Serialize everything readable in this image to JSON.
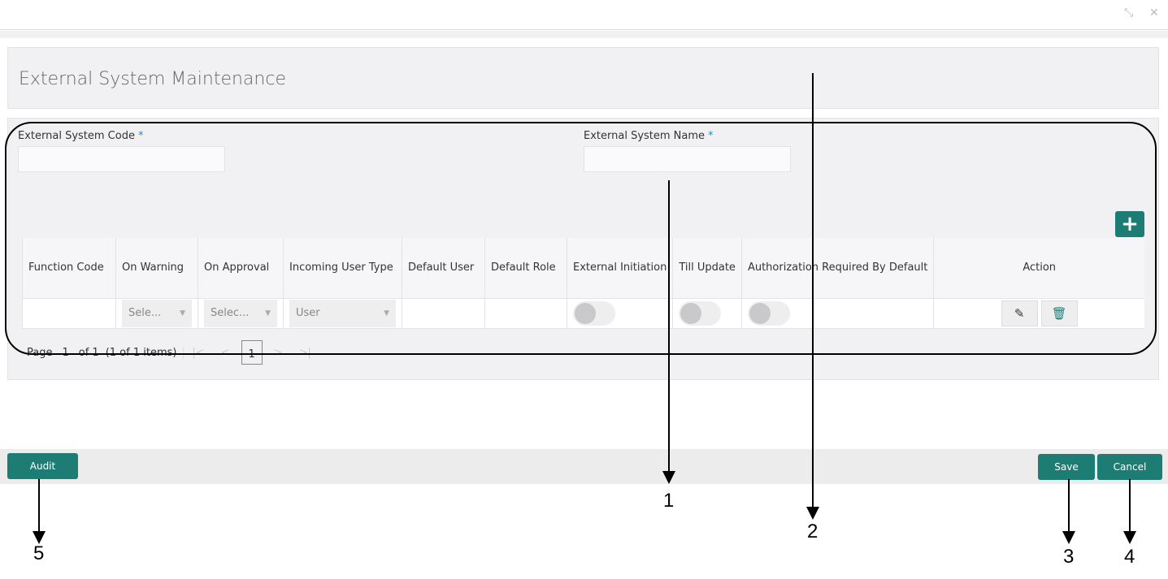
{
  "window": {
    "restore_icon": "collapse-arrows",
    "close_icon": "close-x"
  },
  "header": {
    "title": "External System Maintenance"
  },
  "form": {
    "code_label": "External System Code",
    "code_value": "",
    "name_label": "External System Name",
    "name_value": "",
    "required_mark": "*"
  },
  "table": {
    "columns": [
      "Function Code",
      "On Warning",
      "On Approval",
      "Incoming User Type",
      "Default User",
      "Default Role",
      "External Initiation",
      "Till Update",
      "Authorization Required By Default",
      "Action"
    ],
    "rows": [
      {
        "function_code": "",
        "on_warning": "Sele...",
        "on_approval": "Selec...",
        "incoming_user_type": "User",
        "default_user": "",
        "default_role": "",
        "external_initiation": false,
        "till_update": false,
        "authorization_required": false
      }
    ]
  },
  "pagination": {
    "page_label": "Page",
    "page": "1",
    "of": "of 1",
    "items": "(1 of 1 items)",
    "current": "1"
  },
  "footer": {
    "audit": "Audit",
    "save": "Save",
    "cancel": "Cancel"
  },
  "callouts": [
    "1",
    "2",
    "3",
    "4",
    "5"
  ],
  "colors": {
    "accent": "#1d7d74",
    "required": "#2a8fb8"
  }
}
